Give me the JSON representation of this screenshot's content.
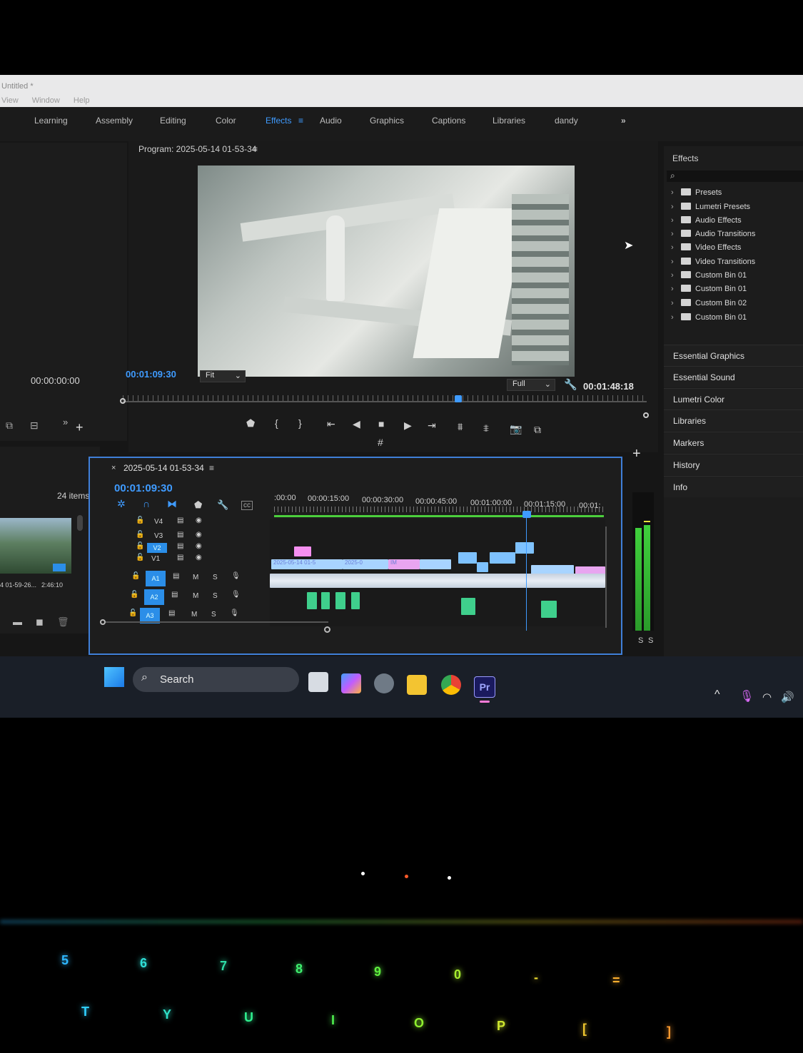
{
  "window": {
    "title": "Untitled *",
    "menu": [
      "View",
      "Window",
      "Help"
    ]
  },
  "workspaces": [
    {
      "label": "Learning",
      "active": false
    },
    {
      "label": "Assembly",
      "active": false
    },
    {
      "label": "Editing",
      "active": false
    },
    {
      "label": "Color",
      "active": false
    },
    {
      "label": "Effects",
      "active": true
    },
    {
      "label": "Audio",
      "active": false
    },
    {
      "label": "Graphics",
      "active": false
    },
    {
      "label": "Captions",
      "active": false
    },
    {
      "label": "Libraries",
      "active": false
    },
    {
      "label": "dandy",
      "active": false
    }
  ],
  "workspace_overflow": "»",
  "source_panel": {
    "timecode": "00:00:00:00",
    "items_count": "24 items",
    "clip_name": "4 01-59-26...",
    "clip_duration": "2:46:10"
  },
  "program_monitor": {
    "title": "Program: 2025-05-14 01-53-34",
    "current_time": "00:01:09:30",
    "zoom": "Fit",
    "resolution": "Full",
    "duration": "00:01:48:18",
    "playhead_fraction": 0.64
  },
  "timeline": {
    "sequence_name": "2025-05-14 01-53-34",
    "current_time": "00:01:09:30",
    "ruler": [
      ":00:00",
      "00:00:15:00",
      "00:00:30:00",
      "00:00:45:00",
      "00:01:00:00",
      "00:01:15:00",
      "00:01:"
    ],
    "video_tracks": [
      "V4",
      "V3",
      "V2",
      "V1"
    ],
    "audio_tracks": [
      "A1",
      "A2",
      "A3"
    ],
    "track_buttons": {
      "mute": "M",
      "solo": "S"
    },
    "clip_labels": [
      "2025-05-14 01-5",
      "2025-0",
      "IM"
    ]
  },
  "effects_panel": {
    "title": "Effects",
    "items": [
      "Presets",
      "Lumetri Presets",
      "Audio Effects",
      "Audio Transitions",
      "Video Effects",
      "Video Transitions",
      "Custom Bin 01",
      "Custom Bin 01",
      "Custom Bin 02",
      "Custom Bin 01"
    ],
    "sections": [
      "Essential Graphics",
      "Essential Sound",
      "Lumetri Color",
      "Libraries",
      "Markers",
      "History",
      "Info"
    ]
  },
  "audio_meter": {
    "labels": [
      "S",
      "S"
    ]
  },
  "taskbar": {
    "search_label": "Search"
  },
  "keyboard": {
    "row1": [
      "5",
      "6",
      "7",
      "8",
      "9",
      "0",
      "-",
      "="
    ],
    "row2": [
      "T",
      "Y",
      "U",
      "I",
      "O",
      "P",
      "[",
      "]"
    ]
  }
}
